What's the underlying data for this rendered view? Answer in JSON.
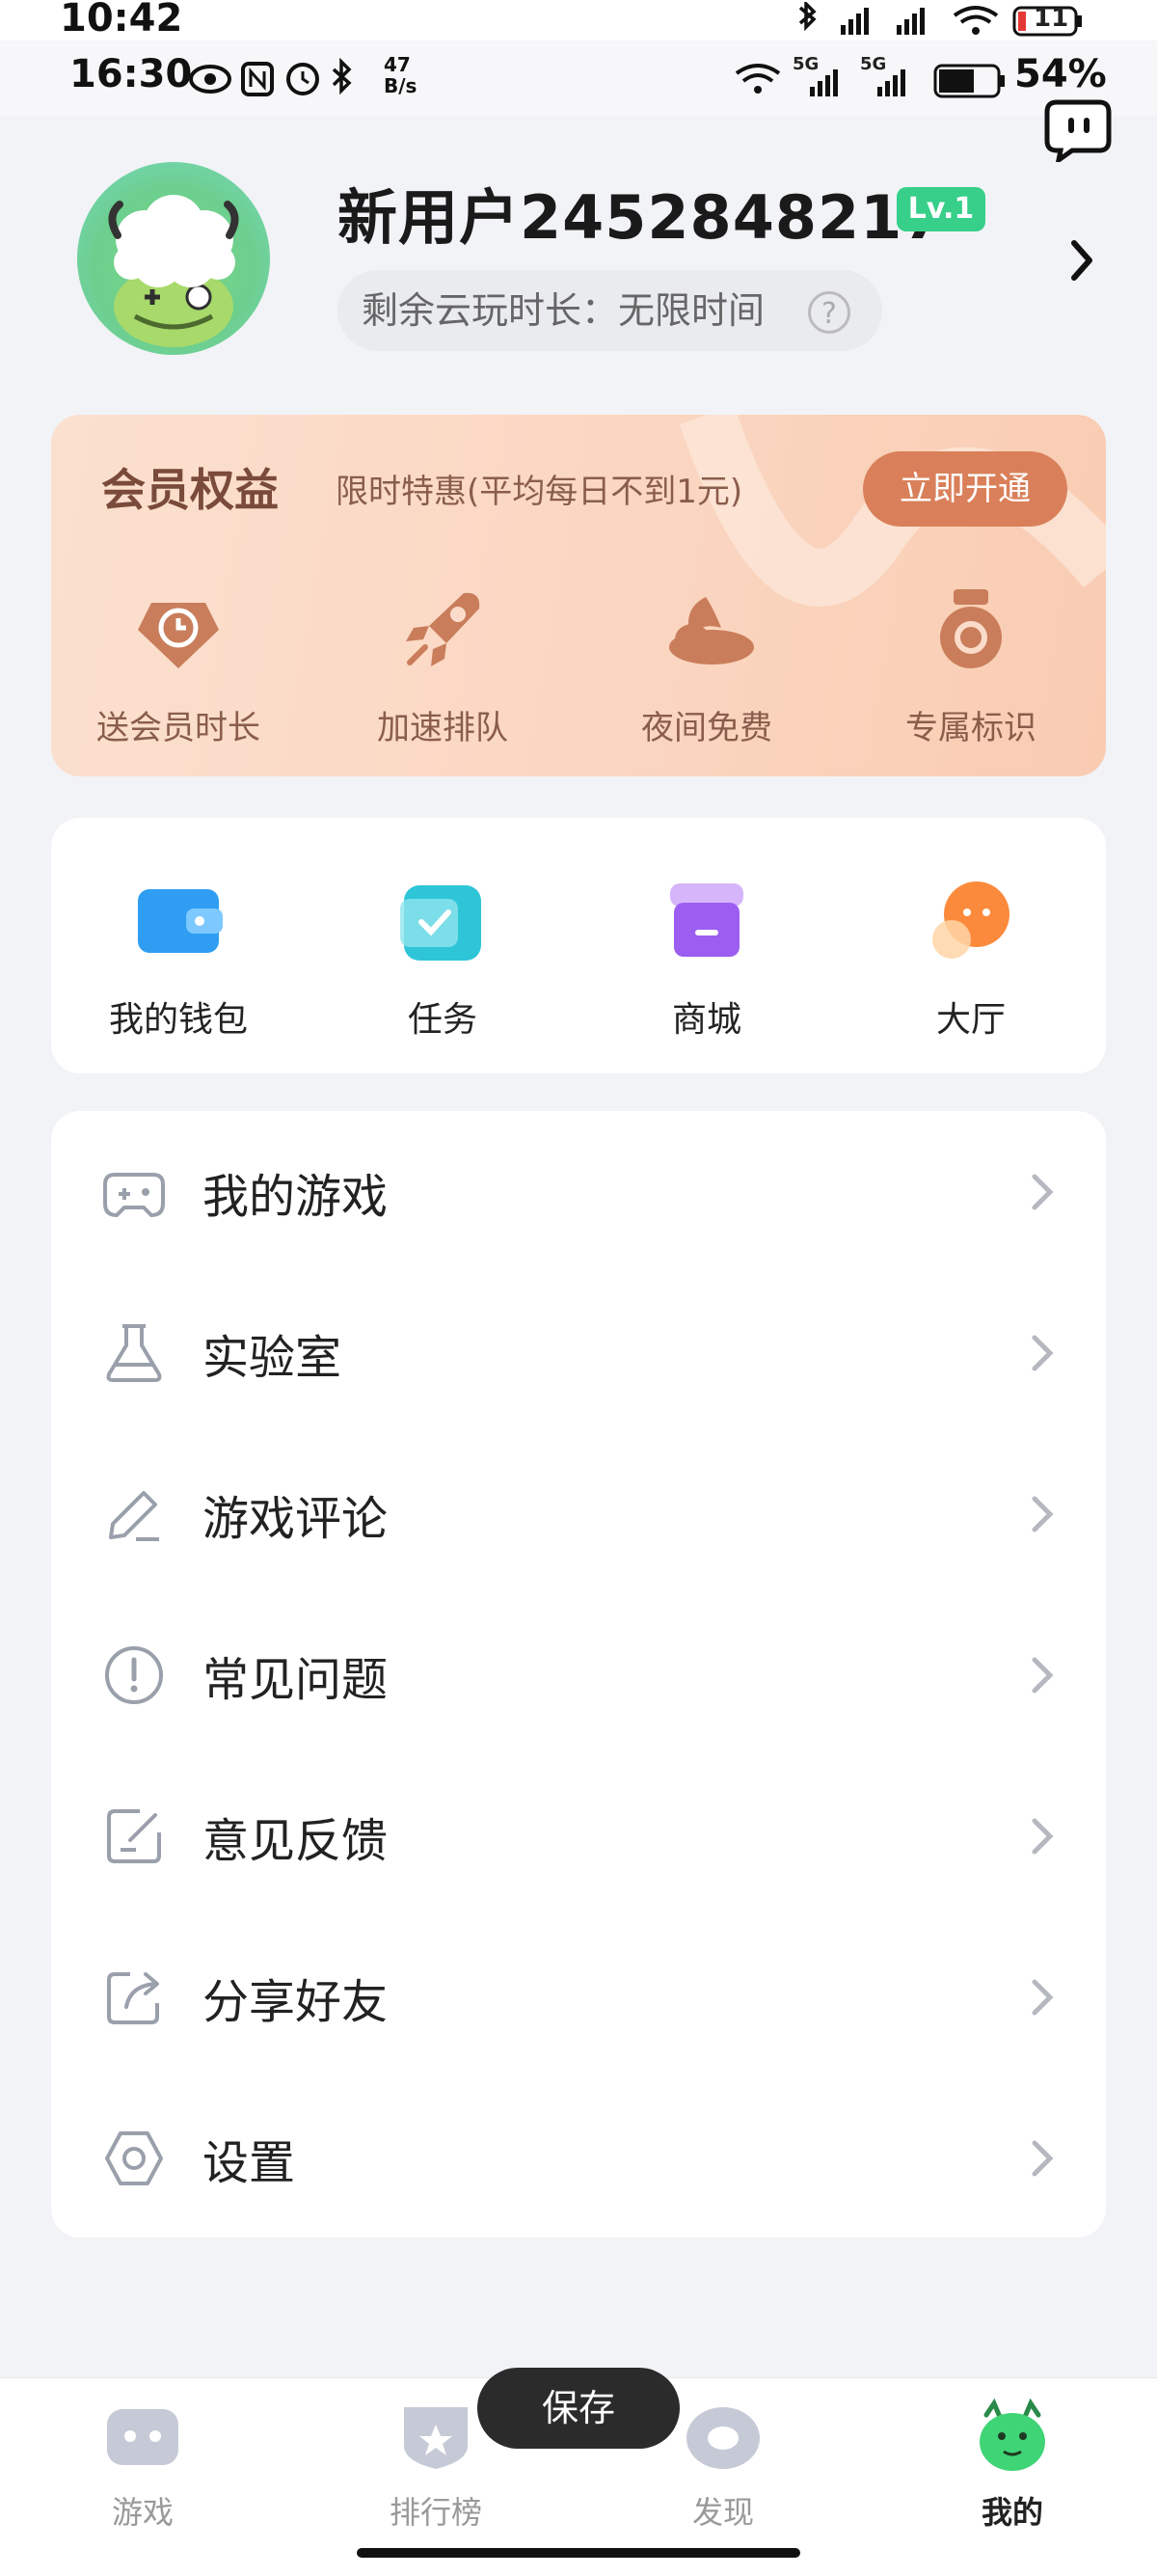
{
  "status_bar": {
    "time": "10:42",
    "battery": "11"
  },
  "status_bar_2": {
    "time": "16:30",
    "net_speed_value": "47",
    "net_speed_unit": "B/s",
    "signal_a": "5G",
    "signal_b": "5G",
    "battery_pct": "54%"
  },
  "profile": {
    "username": "新用户2452848217",
    "level": "Lv.1",
    "cloud_time": "剩余云玩时长：无限时间",
    "help": "?"
  },
  "membership": {
    "title": "会员权益",
    "subtitle": "限时特惠(平均每日不到1元)",
    "cta": "立即开通",
    "perks": [
      {
        "label": "送会员时长",
        "icon": "clock-tag-icon"
      },
      {
        "label": "加速排队",
        "icon": "rocket-icon"
      },
      {
        "label": "夜间免费",
        "icon": "moon-cloud-icon"
      },
      {
        "label": "专属标识",
        "icon": "medal-icon"
      }
    ]
  },
  "quick": [
    {
      "label": "我的钱包",
      "icon": "wallet-icon"
    },
    {
      "label": "任务",
      "icon": "task-icon"
    },
    {
      "label": "商城",
      "icon": "shop-icon"
    },
    {
      "label": "大厅",
      "icon": "hall-icon"
    }
  ],
  "menu": [
    {
      "label": "我的游戏",
      "icon": "gamepad-icon"
    },
    {
      "label": "实验室",
      "icon": "flask-icon"
    },
    {
      "label": "游戏评论",
      "icon": "pencil-icon"
    },
    {
      "label": "常见问题",
      "icon": "exclamation-icon"
    },
    {
      "label": "意见反馈",
      "icon": "feedback-icon"
    },
    {
      "label": "分享好友",
      "icon": "share-icon"
    },
    {
      "label": "设置",
      "icon": "settings-icon"
    }
  ],
  "tabs": [
    {
      "label": "游戏",
      "icon": "game-tab-icon",
      "active": false
    },
    {
      "label": "排行榜",
      "icon": "ranking-tab-icon",
      "active": false
    },
    {
      "label": "发现",
      "icon": "discover-tab-icon",
      "active": false
    },
    {
      "label": "我的",
      "icon": "mine-tab-icon",
      "active": true
    }
  ],
  "toast": "保存",
  "colors": {
    "accent_green": "#37cf8a",
    "member_brown": "#d9805a"
  }
}
